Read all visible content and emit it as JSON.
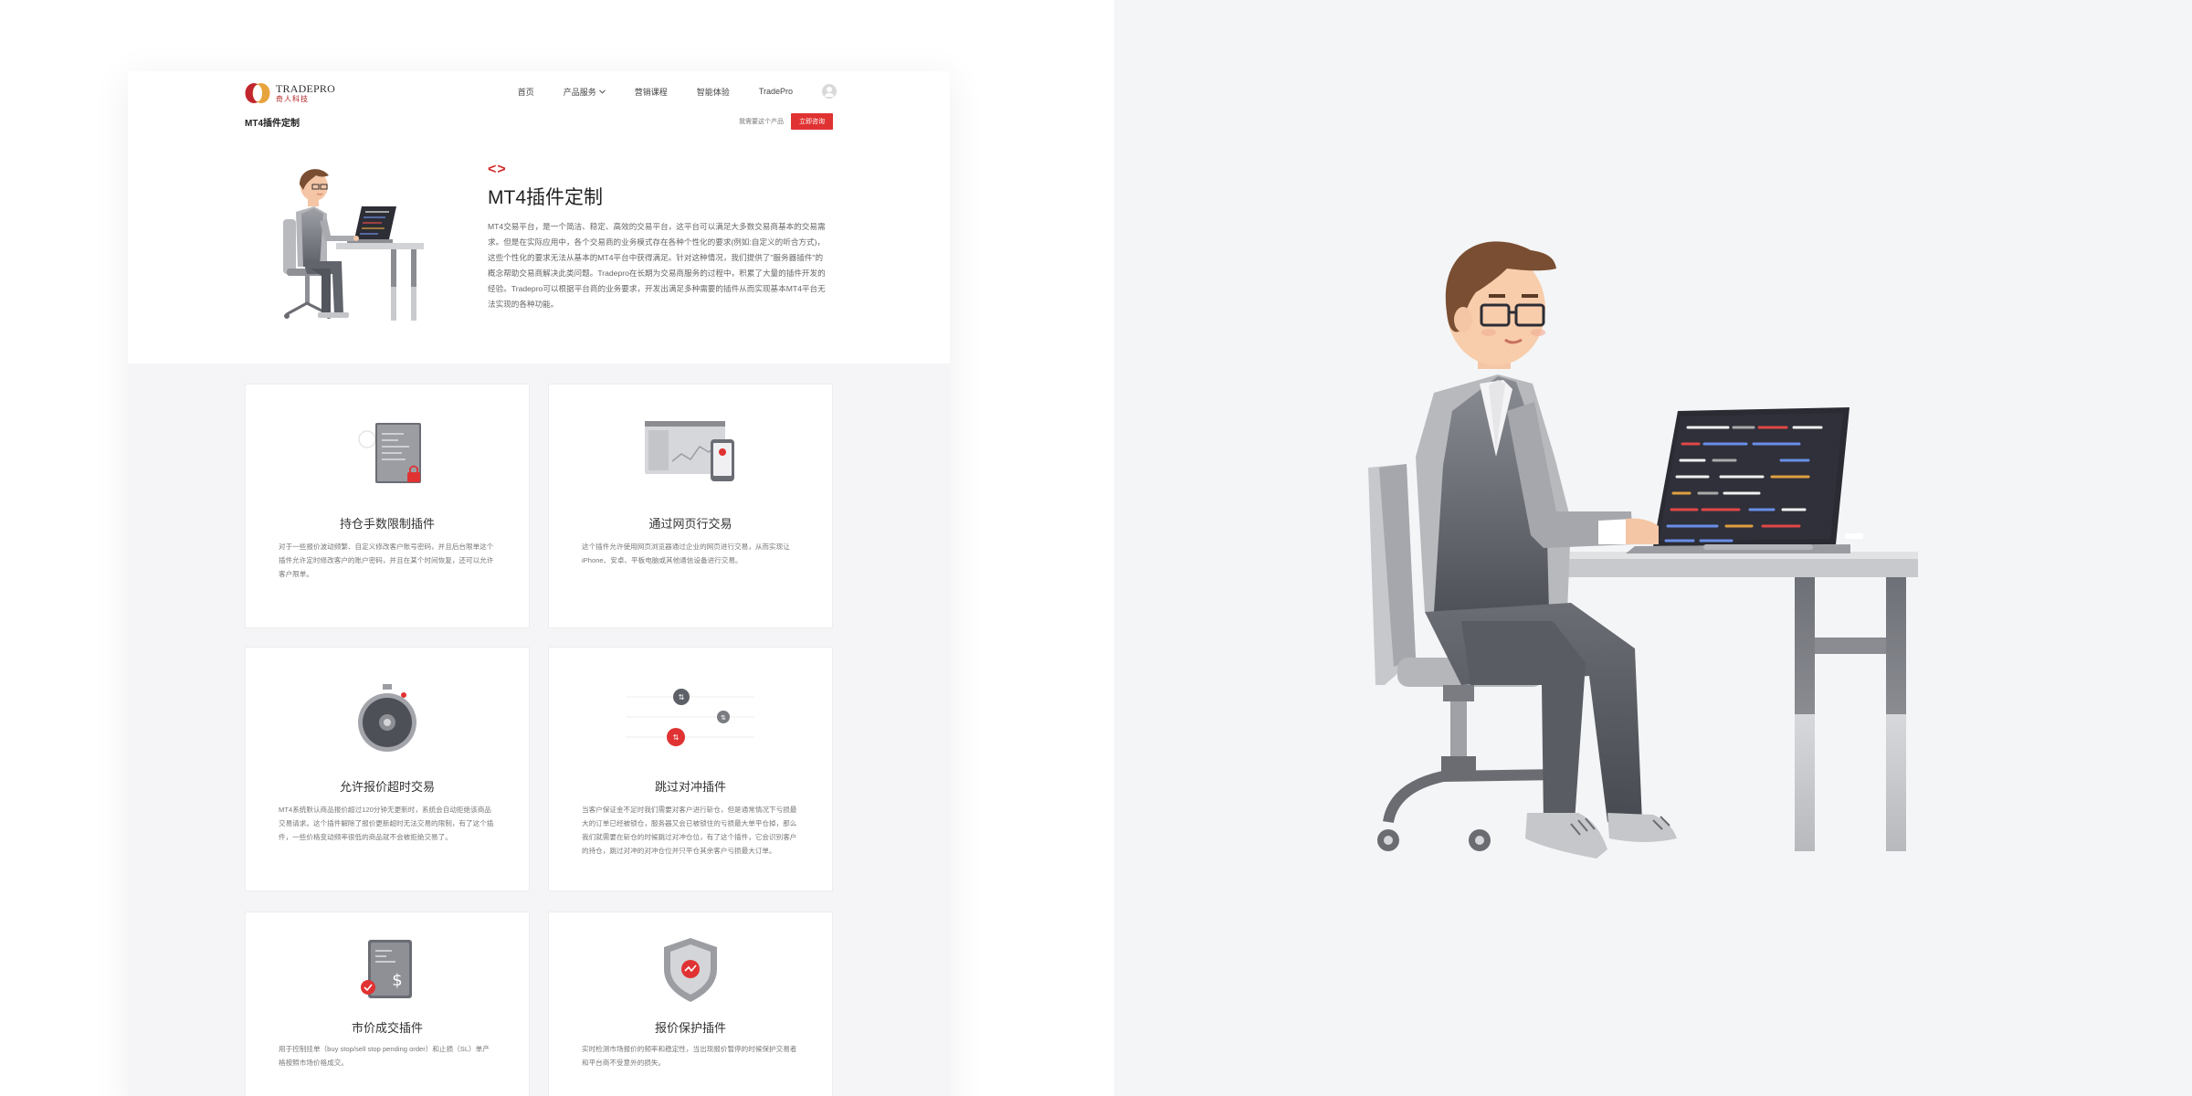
{
  "header": {
    "logo_name": "TRADEPRO",
    "logo_sub": "奇人科技",
    "nav": [
      "首页",
      "产品服务",
      "营销课程",
      "智能体验",
      "TradePro"
    ]
  },
  "subbar": {
    "page_title": "MT4插件定制",
    "help_link": "我需要这个产品",
    "cta": "立即咨询"
  },
  "hero": {
    "code_mark": "<>",
    "heading": "MT4插件定制",
    "description": "MT4交易平台，是一个简洁、稳定、高效的交易平台，这平台可以满足大多数交易商基本的交易需求。但是在实际应用中，各个交易商的业务模式存在各种个性化的要求(例如:自定义的听合方式)，这些个性化的要求无法从基本的MT4平台中获得满足。针对这种情况，我们提供了\"服务器插件\"的概念帮助交易商解决此类问题。Tradepro在长期为交易商服务的过程中，积累了大量的插件开发的经验。Tradepro可以根据平台商的业务要求，开发出满足多种需要的插件从而实现基本MT4平台无法实现的各种功能。"
  },
  "cards": [
    {
      "title": "持仓手数限制插件",
      "desc": "对于一些报价波动频繁、自定义修改客户账号密码，并且后台限单这个插件允许定时修改客户的账户密码，并且在某个时间恢复，还可以允许客户限单。",
      "icon": "document-lock-icon"
    },
    {
      "title": "通过网页行交易",
      "desc": "这个插件允许使用网页浏览器通过企业的网页进行交易，从而实现让iPhone、安卓、平板电脑或其他通信设备进行交易。",
      "icon": "web-trading-icon"
    },
    {
      "title": "允许报价超时交易",
      "desc": "MT4系统默认商品报价超过120分钟无更新时，系统会自动拒绝该商品交易请求。这个插件解除了报价更新超时无法交易的限制，有了这个插件，一些价格变动频率很低的商品就不会被拒绝交易了。",
      "icon": "stopwatch-icon"
    },
    {
      "title": "跳过对冲插件",
      "desc": "当客户保证金不足时我们需要对客户进行斩仓，但是通常情况下亏损最大的订单已经被锁仓，服务器又会已被锁住的亏损最大单平仓掉，那么我们就需要在斩仓的时候跳过对冲仓位，有了这个插件，它会识别客户的持仓，跳过对冲的对冲仓位并只平仓其余客户亏损最大订单。",
      "icon": "hedge-skip-icon"
    },
    {
      "title": "市价成交插件",
      "desc": "用于控制挂单（buy stop/sell stop pending order）和止损（SL）单产格按照市场价格成交。",
      "icon": "invoice-dollar-icon"
    },
    {
      "title": "报价保护插件",
      "desc": "实时检测市场报价的频率和稳定性，当出现报价暂停的时候保护交易者和平台商不受意外的损失。",
      "icon": "shield-chart-icon"
    }
  ],
  "colors": {
    "accent": "#e03232",
    "page_bg": "#f5f5f7",
    "right_bg": "#f4f5f7"
  }
}
